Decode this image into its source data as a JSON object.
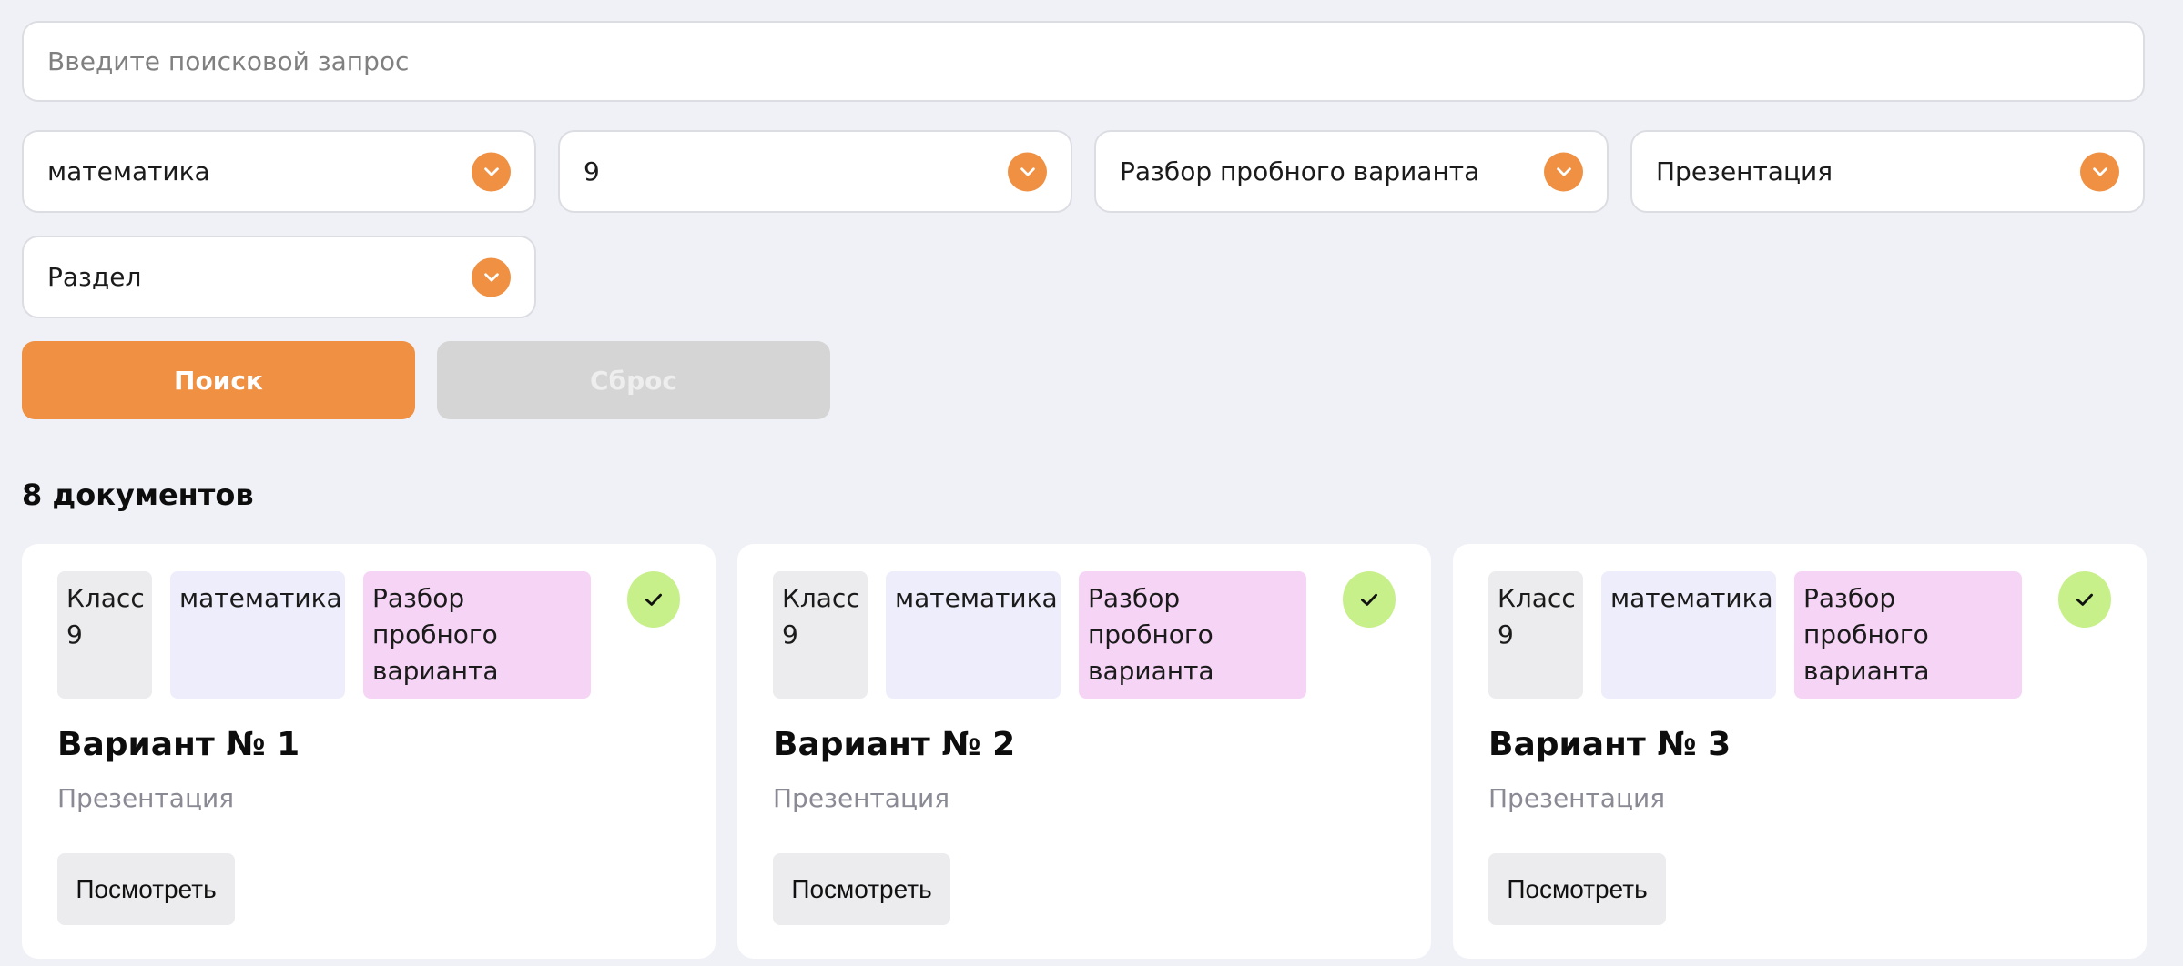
{
  "search": {
    "placeholder": "Введите поисковой запрос",
    "value": ""
  },
  "filters": [
    {
      "label": "математика",
      "icon": "chevron-down-icon"
    },
    {
      "label": "9",
      "icon": "chevron-down-icon"
    },
    {
      "label": "Разбор пробного варианта",
      "icon": "chevron-down-icon"
    },
    {
      "label": "Презентация",
      "icon": "chevron-down-icon"
    },
    {
      "label": "Раздел",
      "icon": "chevron-down-icon"
    }
  ],
  "buttons": {
    "search_label": "Поиск",
    "reset_label": "Сброс"
  },
  "results": {
    "count_label": "8 документов"
  },
  "cards": [
    {
      "class_tag": "Класс 9",
      "subject_tag": "математика",
      "type_tag": "Разбор пробного варианта",
      "title": "Вариант № 1",
      "subtitle": "Презентация",
      "action_label": "Посмотреть",
      "checked_icon": "check-icon"
    },
    {
      "class_tag": "Класс 9",
      "subject_tag": "математика",
      "type_tag": "Разбор пробного варианта",
      "title": "Вариант № 2",
      "subtitle": "Презентация",
      "action_label": "Посмотреть",
      "checked_icon": "check-icon"
    },
    {
      "class_tag": "Класс 9",
      "subject_tag": "математика",
      "type_tag": "Разбор пробного варианта",
      "title": "Вариант № 3",
      "subtitle": "Презентация",
      "action_label": "Посмотреть",
      "checked_icon": "check-icon"
    }
  ],
  "colors": {
    "accent": "#ef9043",
    "background": "#f0f1f6",
    "check": "#c7f08a",
    "tag_class": "#ececee",
    "tag_subject": "#eeedfb",
    "tag_type": "#f6d4f6",
    "reset_button": "#d5d5d5"
  }
}
